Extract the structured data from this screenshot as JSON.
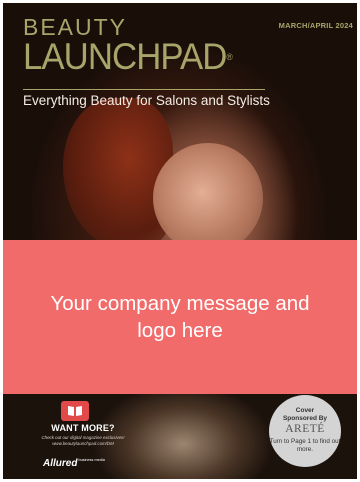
{
  "issue_date": "MARCH/APRIL 2024",
  "masthead": {
    "line1": "BEAUTY",
    "line2": "LAUNCHPAD",
    "registered_mark": "®"
  },
  "tagline": "Everything Beauty for Salons and Stylists",
  "banner": {
    "message": "Your company message and logo here",
    "color": "#f26b6b"
  },
  "promo": {
    "icon": "digital-magazine-icon",
    "title": "WANT MORE?",
    "text": "Check out our digital magazine exclusives! www.beautylaunchpad.com/DM"
  },
  "publisher": {
    "name": "Allured",
    "sub": "business media"
  },
  "sponsor_badge": {
    "line1": "Cover",
    "line2": "Sponsored By",
    "brand": "ARETÉ",
    "turn_text": "Turn to Page 1 to find out more."
  },
  "colors": {
    "masthead": "#a8a56a",
    "banner": "#f26b6b",
    "badge": "#d4d4d4"
  }
}
